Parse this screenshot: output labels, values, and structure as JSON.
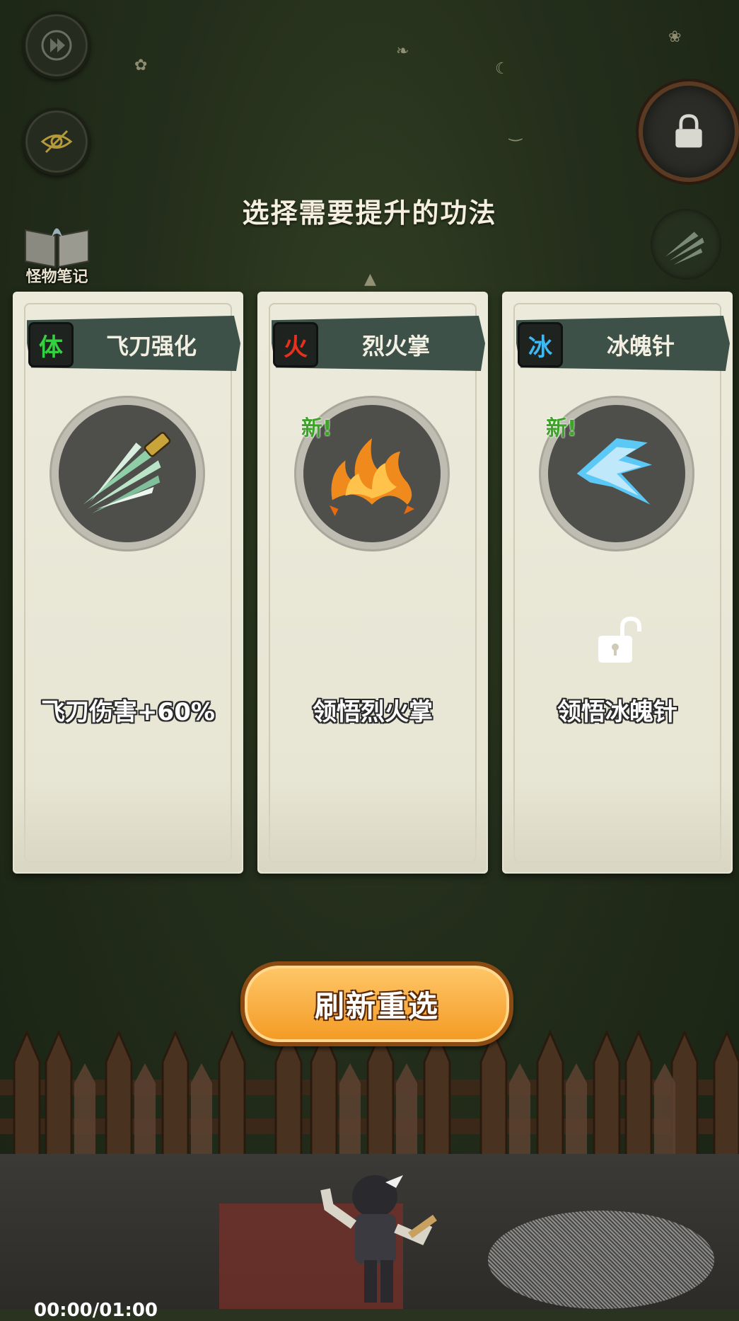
{
  "header": {
    "title": "选择需要提升的功法"
  },
  "sidebar": {
    "monster_notes_label": "怪物笔记"
  },
  "cards": [
    {
      "element": "体",
      "element_color": "#35d040",
      "name": "飞刀强化",
      "description": "飞刀伤害+60%",
      "new_tag": "",
      "icon": "flying-knife-icon"
    },
    {
      "element": "火",
      "element_color": "#e8301c",
      "name": "烈火掌",
      "description": "领悟烈火掌",
      "new_tag": "新!",
      "icon": "fire-palm-icon"
    },
    {
      "element": "冰",
      "element_color": "#3fb7f0",
      "name": "冰魄针",
      "description": "领悟冰魄针",
      "new_tag": "新!",
      "icon": "ice-needle-icon"
    }
  ],
  "footer": {
    "refresh_label": "刷新重选",
    "timer_text": "00:00/01:00"
  }
}
